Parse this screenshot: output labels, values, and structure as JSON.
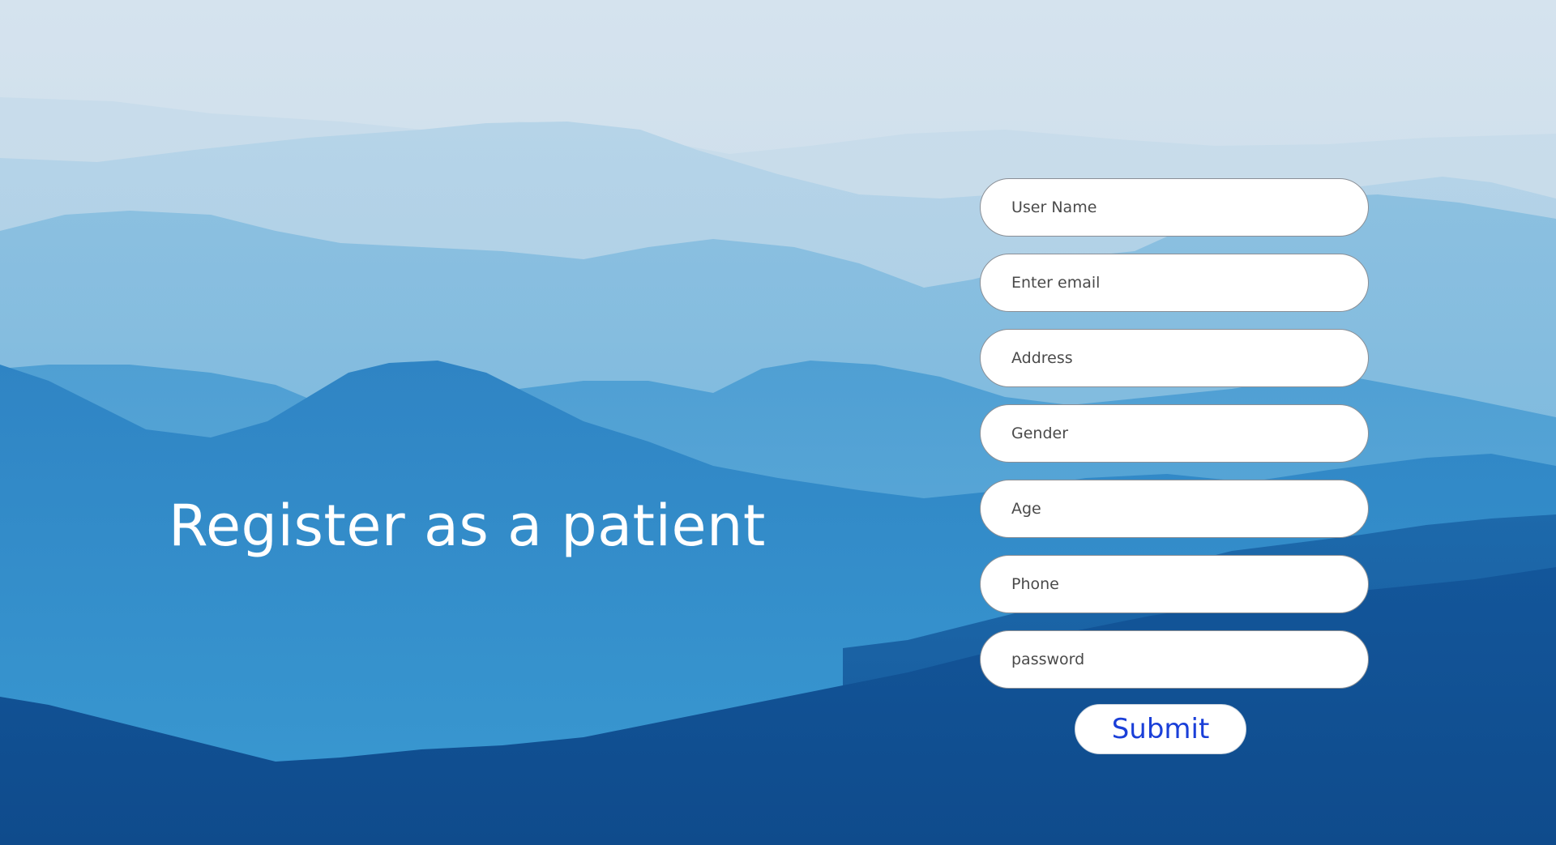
{
  "hero": {
    "title": "Register as a patient"
  },
  "form": {
    "fields": [
      {
        "name": "username",
        "placeholder": "User Name",
        "type": "text"
      },
      {
        "name": "email",
        "placeholder": "Enter email",
        "type": "email"
      },
      {
        "name": "address",
        "placeholder": "Address",
        "type": "text"
      },
      {
        "name": "gender",
        "placeholder": "Gender",
        "type": "text"
      },
      {
        "name": "age",
        "placeholder": "Age",
        "type": "text"
      },
      {
        "name": "phone",
        "placeholder": "Phone",
        "type": "text"
      },
      {
        "name": "password",
        "placeholder": "password",
        "type": "password"
      }
    ],
    "submit_label": "Submit"
  },
  "colors": {
    "title_text": "#ffffff",
    "submit_text": "#1a3fd8",
    "field_background": "#ffffff",
    "field_border": "#8a8f96"
  }
}
